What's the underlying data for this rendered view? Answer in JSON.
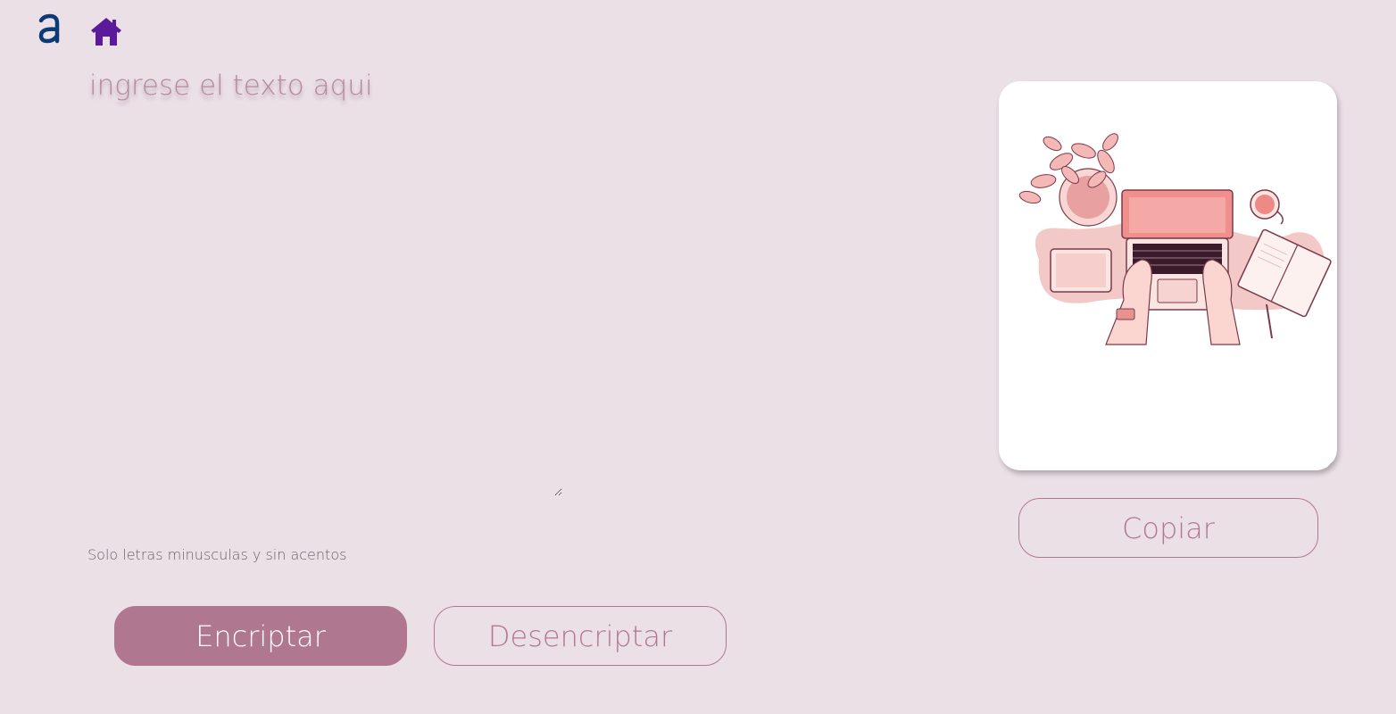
{
  "header": {
    "logo_icon": "alura-logo-icon",
    "home_icon": "home-icon"
  },
  "input": {
    "placeholder": "ingrese el texto aqui",
    "value": ""
  },
  "hint": {
    "text": "Solo letras minusculas y sin acentos"
  },
  "actions": {
    "encrypt_label": "Encriptar",
    "decrypt_label": "Desencriptar"
  },
  "output": {
    "illustration": "person-typing-on-laptop-illustration",
    "copy_label": "Copiar"
  },
  "colors": {
    "background": "#ece0e7",
    "accent": "#b07890",
    "logo": "#0b3a77",
    "home": "#5b1a99"
  }
}
